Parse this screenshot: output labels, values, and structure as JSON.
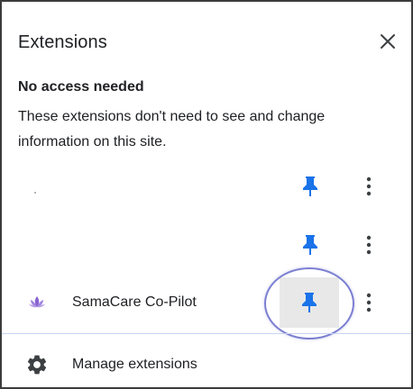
{
  "header": {
    "title": "Extensions",
    "close_icon": "close-icon"
  },
  "section": {
    "heading": "No access needed",
    "description": "These extensions don't need to see and change information on this site."
  },
  "extensions": [
    {
      "name": "",
      "icon": "blank-icon",
      "pinned": true
    },
    {
      "name": "",
      "icon": "blank-icon",
      "pinned": true
    },
    {
      "name": "SamaCare Co-Pilot",
      "icon": "lotus-icon",
      "pinned": true,
      "highlighted": true
    }
  ],
  "footer": {
    "manage_label": "Manage extensions",
    "icon": "gear-icon"
  },
  "colors": {
    "pin_blue": "#1a73e8",
    "lotus_purple": "#8a63d2",
    "highlight_ring": "#7b7fd0",
    "hover_bg": "#e8e8e8"
  }
}
